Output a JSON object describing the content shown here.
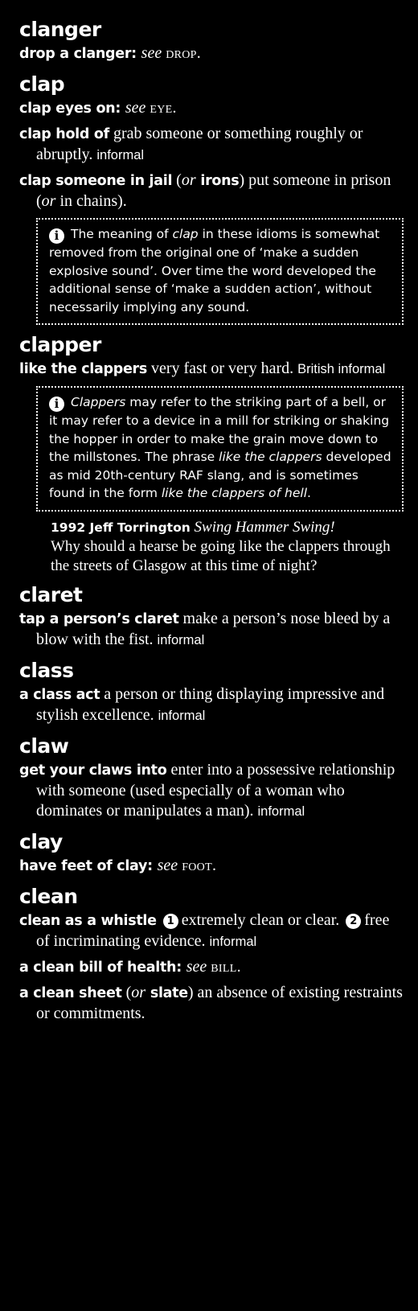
{
  "entries": [
    {
      "headword": "clanger",
      "idioms": [
        {
          "phrase": "drop a clanger",
          "sep": ": ",
          "see": "see",
          "xref": "drop",
          "end": "."
        }
      ]
    },
    {
      "headword": "clap",
      "idioms": [
        {
          "phrase": "clap eyes on",
          "sep": ": ",
          "see": "see",
          "xref": "eye",
          "end": "."
        },
        {
          "phrase": "clap hold of",
          "definition": " grab someone or something roughly or abruptly. ",
          "register": "informal"
        },
        {
          "phrase": "clap someone in jail",
          "open": " (",
          "or": "or",
          "phrase2": " irons",
          "close": ")",
          "definition": " put someone in prison (",
          "or2": "or",
          "definition2": " in chains)."
        }
      ],
      "note": {
        "icon": "i",
        "t1": "The meaning of ",
        "i1": "clap",
        "t2": " in these idioms is somewhat removed from the original one of ‘make a sudden explosive sound’. Over time the word developed the additional sense of ‘make a sudden action’, without necessarily implying any sound."
      }
    },
    {
      "headword": "clapper",
      "idioms": [
        {
          "phrase": "like the clappers",
          "definition": " very fast or very hard. ",
          "register": "British informal"
        }
      ],
      "note": {
        "icon": "i",
        "i1": "Clappers",
        "t1": " may refer to the striking part of a bell, or it may refer to a device in a mill for striking or shaking the hopper in order to make the grain move down to the millstones. The phrase ",
        "i2": "like the clappers",
        "t2": " developed as mid 20th-century RAF slang, and is sometimes found in the form ",
        "i3": "like the clappers of hell",
        "t3": "."
      },
      "quote": {
        "source": "1992 Jeff Torrington",
        "title": "Swing Hammer Swing!",
        "text": "Why should a hearse be going like the clappers through the streets of Glasgow at this time of night?"
      }
    },
    {
      "headword": "claret",
      "idioms": [
        {
          "phrase": "tap a person’s claret",
          "definition": " make a person’s nose bleed by a blow with the fist. ",
          "register": "informal"
        }
      ]
    },
    {
      "headword": "class",
      "idioms": [
        {
          "phrase": "a class act",
          "definition": " a person or thing displaying impressive and stylish excellence. ",
          "register": "informal"
        }
      ]
    },
    {
      "headword": "claw",
      "idioms": [
        {
          "phrase": "get your claws into",
          "definition": " enter into a possessive relationship with someone (used especially of a woman who dominates or manipulates a man). ",
          "register": "informal"
        }
      ]
    },
    {
      "headword": "clay",
      "idioms": [
        {
          "phrase": "have feet of clay",
          "sep": ": ",
          "see": "see",
          "xref": "foot",
          "end": "."
        }
      ]
    },
    {
      "headword": "clean",
      "idioms": [
        {
          "phrase": "clean as a whistle",
          "n1": "1",
          "sense1": "extremely clean or clear.",
          "n2": "2",
          "sense2": "free of incriminating evidence. ",
          "register": "informal"
        },
        {
          "phrase": "a clean bill of health",
          "sep": ": ",
          "see": "see",
          "xref": "bill",
          "end": "."
        },
        {
          "phrase": "a clean sheet",
          "open": " (",
          "or": "or",
          "phrase2": " slate",
          "close": ")",
          "definition": " an absence of existing restraints or commitments."
        }
      ]
    }
  ]
}
